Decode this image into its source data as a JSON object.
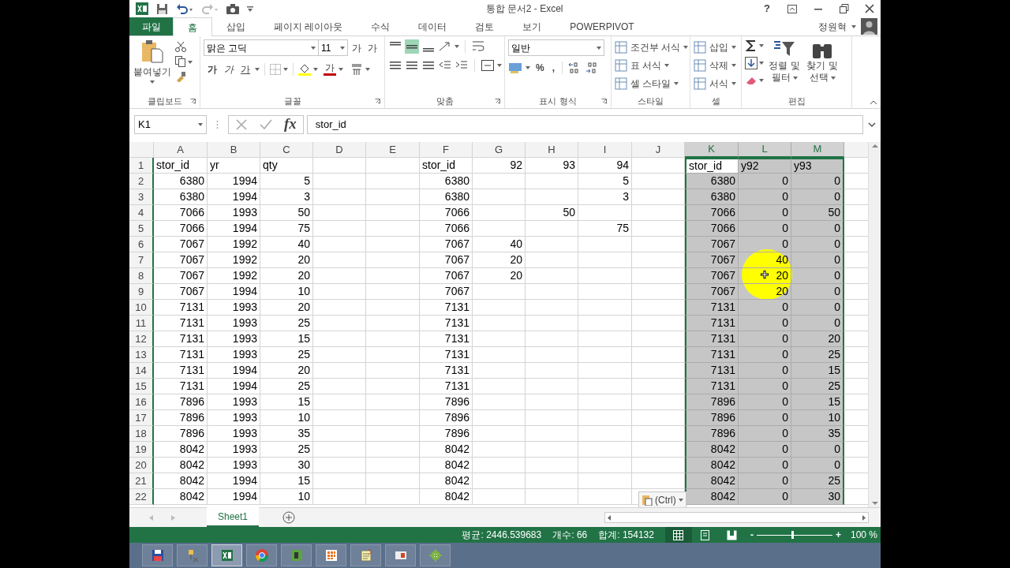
{
  "window": {
    "title": "통합 문서2 - Excel",
    "help": "?"
  },
  "tabs": [
    {
      "label": "파일",
      "kind": "file",
      "selected": false
    },
    {
      "label": "홈",
      "kind": "tab",
      "selected": true
    },
    {
      "label": "삽입",
      "kind": "tab",
      "selected": false
    },
    {
      "label": "페이지 레이아웃",
      "kind": "tab",
      "selected": false
    },
    {
      "label": "수식",
      "kind": "tab",
      "selected": false
    },
    {
      "label": "데이터",
      "kind": "tab",
      "selected": false
    },
    {
      "label": "검토",
      "kind": "tab",
      "selected": false
    },
    {
      "label": "보기",
      "kind": "tab",
      "selected": false
    },
    {
      "label": "POWERPIVOT",
      "kind": "tab",
      "selected": false
    }
  ],
  "user": {
    "name": "정원혁"
  },
  "ribbon": {
    "clipboard": {
      "label": "클립보드",
      "paste": "붙여넣기"
    },
    "font": {
      "label": "글꼴",
      "font_name": "맑은 고딕",
      "font_size": "11",
      "grow": "가",
      "shrink": "가",
      "bold": "가",
      "italic": "가",
      "underline": "가",
      "font_color": "가"
    },
    "alignment": {
      "label": "맞춤"
    },
    "number": {
      "label": "표시 형식",
      "format": "일반",
      "percent": "%",
      "comma": ","
    },
    "styles": {
      "label": "스타일",
      "items": [
        "조건부 서식",
        "표 서식",
        "셀 스타일"
      ]
    },
    "cells": {
      "label": "셀",
      "items": [
        "삽입",
        "삭제",
        "서식"
      ]
    },
    "editing": {
      "label": "편집",
      "sort": [
        "정렬 및",
        "필터"
      ],
      "find": [
        "찾기 및",
        "선택"
      ]
    }
  },
  "formula_bar": {
    "name_box": "K1",
    "fx": "fx",
    "content": "stor_id"
  },
  "sheet": {
    "columns": [
      {
        "label": "A",
        "selected": false
      },
      {
        "label": "B",
        "selected": false
      },
      {
        "label": "C",
        "selected": false
      },
      {
        "label": "D",
        "selected": false
      },
      {
        "label": "E",
        "selected": false
      },
      {
        "label": "F",
        "selected": false
      },
      {
        "label": "G",
        "selected": false
      },
      {
        "label": "H",
        "selected": false
      },
      {
        "label": "I",
        "selected": false
      },
      {
        "label": "J",
        "selected": false
      },
      {
        "label": "K",
        "selected": true
      },
      {
        "label": "L",
        "selected": true
      },
      {
        "label": "M",
        "selected": true
      }
    ],
    "rows": [
      {
        "number": "1",
        "cells": {
          "A": "stor_id",
          "B": "yr",
          "C": "qty",
          "F": "stor_id",
          "G": "92",
          "H": "93",
          "I": "94",
          "L": "y92",
          "M": "y93"
        },
        "active_cells": {
          "K": "stor_id"
        }
      },
      {
        "number": "2",
        "cells": {
          "A": "6380",
          "B": "1994",
          "C": "5",
          "F": "6380",
          "I": "5",
          "K": "6380",
          "L": "0",
          "M": "0"
        }
      },
      {
        "number": "3",
        "cells": {
          "A": "6380",
          "B": "1994",
          "C": "3",
          "F": "6380",
          "I": "3",
          "K": "6380",
          "L": "0",
          "M": "0"
        }
      },
      {
        "number": "4",
        "cells": {
          "A": "7066",
          "B": "1993",
          "C": "50",
          "F": "7066",
          "H": "50",
          "K": "7066",
          "L": "0",
          "M": "50"
        }
      },
      {
        "number": "5",
        "cells": {
          "A": "7066",
          "B": "1994",
          "C": "75",
          "F": "7066",
          "I": "75",
          "K": "7066",
          "L": "0",
          "M": "0"
        }
      },
      {
        "number": "6",
        "cells": {
          "A": "7067",
          "B": "1992",
          "C": "40",
          "F": "7067",
          "G": "40",
          "K": "7067",
          "L": "0",
          "M": "0"
        }
      },
      {
        "number": "7",
        "cells": {
          "A": "7067",
          "B": "1992",
          "C": "20",
          "F": "7067",
          "G": "20",
          "K": "7067",
          "L": "40",
          "M": "0"
        }
      },
      {
        "number": "8",
        "cells": {
          "A": "7067",
          "B": "1992",
          "C": "20",
          "F": "7067",
          "G": "20",
          "K": "7067",
          "L": "20",
          "M": "0"
        }
      },
      {
        "number": "9",
        "cells": {
          "A": "7067",
          "B": "1994",
          "C": "10",
          "F": "7067",
          "K": "7067",
          "L": "20",
          "M": "0"
        }
      },
      {
        "number": "10",
        "cells": {
          "A": "7131",
          "B": "1993",
          "C": "20",
          "F": "7131",
          "K": "7131",
          "L": "0",
          "M": "0"
        }
      },
      {
        "number": "11",
        "cells": {
          "A": "7131",
          "B": "1993",
          "C": "25",
          "F": "7131",
          "K": "7131",
          "L": "0",
          "M": "0"
        }
      },
      {
        "number": "12",
        "cells": {
          "A": "7131",
          "B": "1993",
          "C": "15",
          "F": "7131",
          "K": "7131",
          "L": "0",
          "M": "20"
        }
      },
      {
        "number": "13",
        "cells": {
          "A": "7131",
          "B": "1993",
          "C": "25",
          "F": "7131",
          "K": "7131",
          "L": "0",
          "M": "25"
        }
      },
      {
        "number": "14",
        "cells": {
          "A": "7131",
          "B": "1994",
          "C": "20",
          "F": "7131",
          "K": "7131",
          "L": "0",
          "M": "15"
        }
      },
      {
        "number": "15",
        "cells": {
          "A": "7131",
          "B": "1994",
          "C": "25",
          "F": "7131",
          "K": "7131",
          "L": "0",
          "M": "25"
        }
      },
      {
        "number": "16",
        "cells": {
          "A": "7896",
          "B": "1993",
          "C": "15",
          "F": "7896",
          "K": "7896",
          "L": "0",
          "M": "15"
        }
      },
      {
        "number": "17",
        "cells": {
          "A": "7896",
          "B": "1993",
          "C": "10",
          "F": "7896",
          "K": "7896",
          "L": "0",
          "M": "10"
        }
      },
      {
        "number": "18",
        "cells": {
          "A": "7896",
          "B": "1993",
          "C": "35",
          "F": "7896",
          "K": "7896",
          "L": "0",
          "M": "35"
        }
      },
      {
        "number": "19",
        "cells": {
          "A": "8042",
          "B": "1993",
          "C": "25",
          "F": "8042",
          "K": "8042",
          "L": "0",
          "M": "0"
        }
      },
      {
        "number": "20",
        "cells": {
          "A": "8042",
          "B": "1993",
          "C": "30",
          "F": "8042",
          "K": "8042",
          "L": "0",
          "M": "0"
        }
      },
      {
        "number": "21",
        "cells": {
          "A": "8042",
          "B": "1994",
          "C": "15",
          "F": "8042",
          "K": "8042",
          "L": "0",
          "M": "25"
        }
      },
      {
        "number": "22",
        "cells": {
          "A": "8042",
          "B": "1994",
          "C": "10",
          "F": "8042",
          "K": "8042",
          "L": "0",
          "M": "30"
        }
      }
    ]
  },
  "paste_options": {
    "label": "(Ctrl)"
  },
  "sheet_tabs": [
    {
      "label": "Sheet1",
      "selected": true
    }
  ],
  "status_bar": {
    "items": [
      "평균: 2446.539683",
      "개수: 66",
      "합계: 154132"
    ],
    "views": [
      {
        "kind": "normal",
        "selected": true
      },
      {
        "kind": "page_layout",
        "selected": false
      },
      {
        "kind": "page_break",
        "selected": false
      }
    ],
    "zoom": {
      "level": 0.47,
      "label": "100 %",
      "zoom_out": "-",
      "zoom_in": "+"
    }
  },
  "taskbar": [
    {
      "kind": "save",
      "selected": false
    },
    {
      "kind": "tools",
      "selected": false
    },
    {
      "kind": "excel",
      "selected": true
    },
    {
      "kind": "browser",
      "selected": false
    },
    {
      "kind": "note",
      "selected": false
    },
    {
      "kind": "grid",
      "selected": false
    },
    {
      "kind": "notepad",
      "selected": false
    },
    {
      "kind": "slides",
      "selected": false
    },
    {
      "kind": "gear",
      "selected": false
    }
  ]
}
